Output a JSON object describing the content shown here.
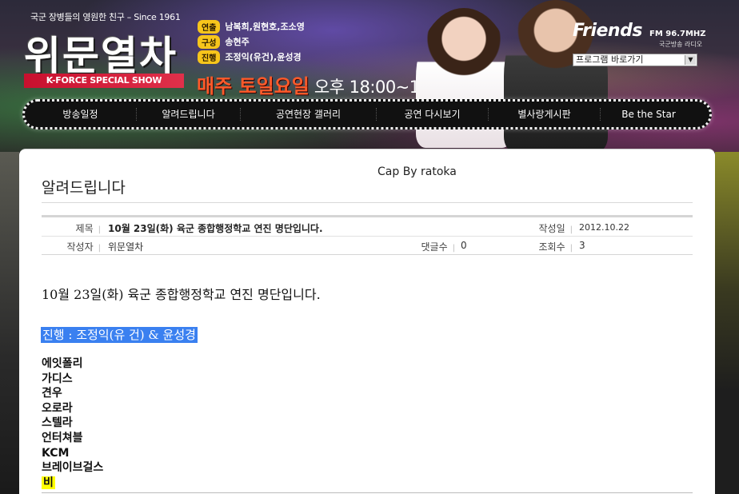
{
  "header": {
    "tagline": "국군 장병들의 영원한 친구 – Since 1961",
    "logo": "위문열차",
    "subtitle": "K-FORCE SPECIAL SHOW",
    "credits": [
      {
        "role": "연출",
        "names": "남복희,원현호,조소영"
      },
      {
        "role": "구성",
        "names": "송현주"
      },
      {
        "role": "진행",
        "names": "조정익(유건),윤성경"
      }
    ],
    "schedule_day": "매주 토일요일",
    "schedule_time": "오후 18:00~19:30",
    "station_name": "Friends",
    "station_freq": "FM 96.7MHZ",
    "station_sub": "국군방송 라디오",
    "program_select": "프로그램 바로가기"
  },
  "nav": {
    "items": [
      "방송일정",
      "알려드립니다",
      "공연현장 갤러리",
      "공연 다시보기",
      "별사랑게시판",
      "Be the Star"
    ]
  },
  "page": {
    "cap": "Cap By ratoka",
    "title": "알려드립니다"
  },
  "meta": {
    "subject_label": "제목",
    "subject": "10월 23일(화) 육군 종합행정학교 연진 명단입니다.",
    "date_label": "작성일",
    "date": "2012.10.22",
    "author_label": "작성자",
    "author": "위문열차",
    "comments_label": "댓글수",
    "comments": "0",
    "views_label": "조회수",
    "views": "3"
  },
  "post": {
    "heading": "10월 23일(화) 육군 종합행정학교 연진 명단입니다.",
    "host_line": "진행 : 조정익(유 건) & 윤성경",
    "lineup": [
      "에잇폴리",
      "가디스",
      "견우",
      "오로라",
      "스텔라",
      "언터쳐블",
      "KCM",
      "브레이브걸스",
      "비"
    ]
  },
  "colors": {
    "highlight_blue": "#3a80f0",
    "highlight_yellow": "#ffff00",
    "logo_red": "#c8102e",
    "credit_tag": "#f7c51b"
  }
}
